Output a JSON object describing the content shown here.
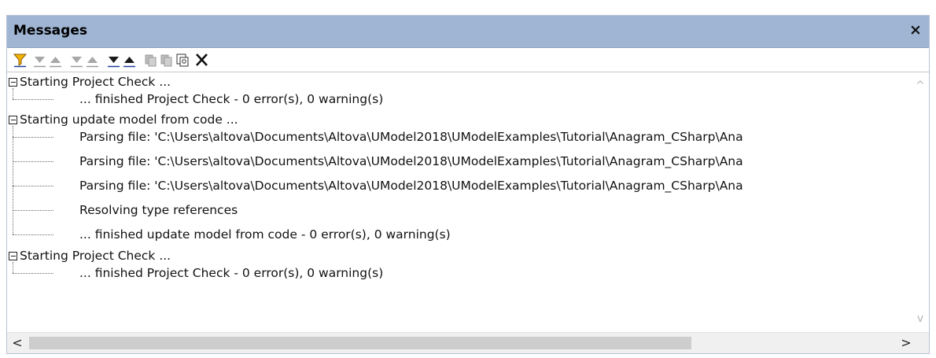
{
  "panel": {
    "title": "Messages",
    "close_glyph": "×"
  },
  "toolbar": {
    "buttons": [
      {
        "name": "filter-icon"
      },
      {
        "name": "next-warning-icon"
      },
      {
        "name": "previous-warning-icon"
      },
      {
        "name": "next-message-icon"
      },
      {
        "name": "previous-message-icon"
      },
      {
        "name": "next-error-icon"
      },
      {
        "name": "previous-error-icon"
      },
      {
        "name": "copy-selected-icon"
      },
      {
        "name": "copy-all-icon"
      },
      {
        "name": "find-icon"
      },
      {
        "name": "clear-icon"
      }
    ]
  },
  "messages": {
    "groups": [
      {
        "header": "Starting Project Check ...",
        "children": [
          "... finished Project Check - 0 error(s), 0 warning(s)"
        ]
      },
      {
        "header": "Starting update model from code ...",
        "children": [
          "Parsing file: 'C:\\Users\\altova\\Documents\\Altova\\UModel2018\\UModelExamples\\Tutorial\\Anagram_CSharp\\Ana",
          "Parsing file: 'C:\\Users\\altova\\Documents\\Altova\\UModel2018\\UModelExamples\\Tutorial\\Anagram_CSharp\\Ana",
          "Parsing file: 'C:\\Users\\altova\\Documents\\Altova\\UModel2018\\UModelExamples\\Tutorial\\Anagram_CSharp\\Ana",
          "Resolving type references",
          "... finished update model from code - 0 error(s), 0 warning(s)"
        ]
      },
      {
        "header": "Starting Project Check ...",
        "children": [
          "... finished Project Check - 0 error(s), 0 warning(s)"
        ]
      }
    ]
  },
  "scrollbars": {
    "up_glyph": "^",
    "down_glyph": "v",
    "left_glyph": "<",
    "right_glyph": ">"
  },
  "colors": {
    "titlebar": "#9fb5d3",
    "filter_icon": "#f0b400"
  }
}
